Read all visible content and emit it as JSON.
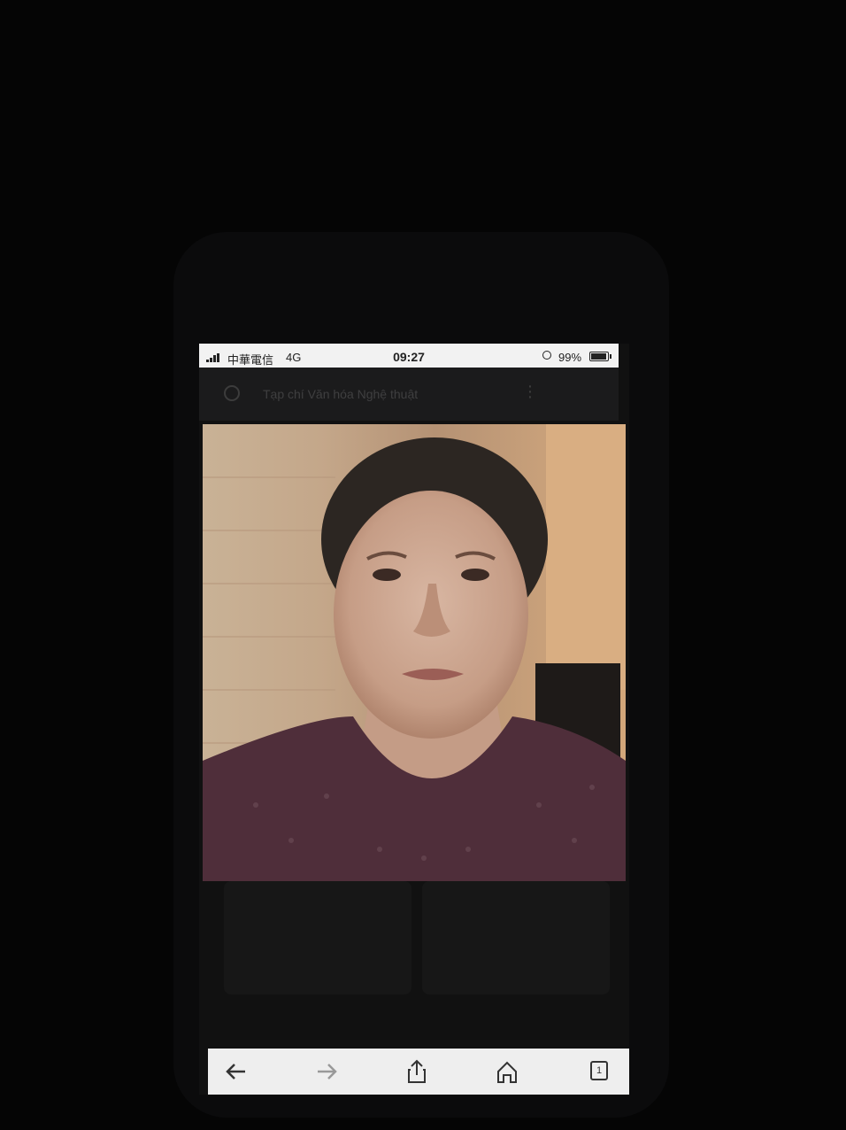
{
  "status_bar": {
    "carrier": "中華電信",
    "network": "4G",
    "time": "09:27",
    "battery": "99%"
  },
  "page": {
    "site_title": "Tạp chí Văn hóa Nghệ thuật"
  },
  "toolbar": {
    "tab_count": "1",
    "icons": [
      "back-icon",
      "forward-icon",
      "share-icon",
      "home-icon",
      "tabs-icon"
    ]
  }
}
